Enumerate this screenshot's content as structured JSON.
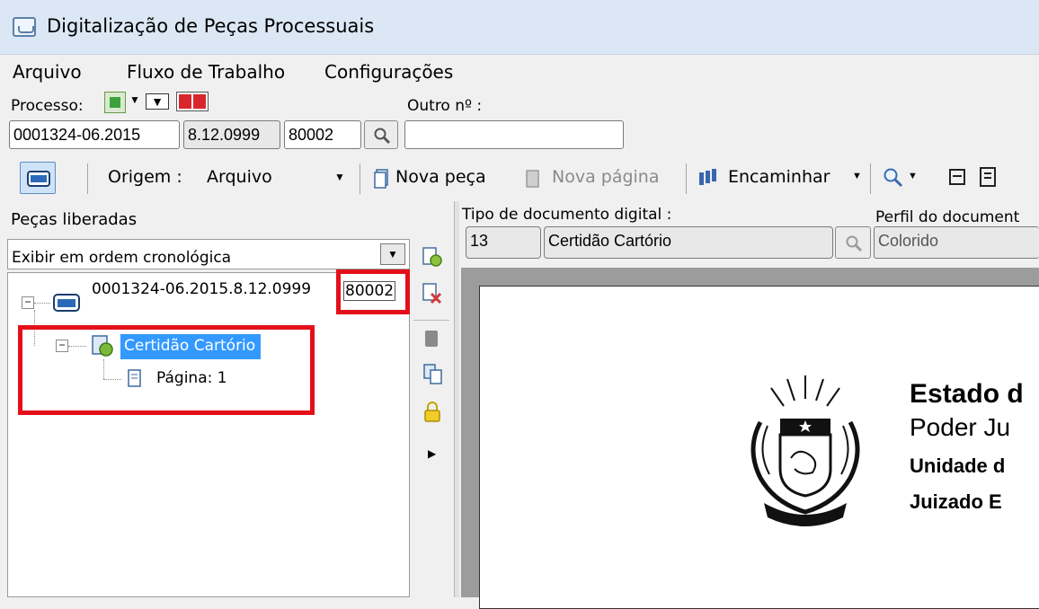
{
  "window": {
    "title": "Digitalização de Peças Processuais"
  },
  "menu": {
    "file": "Arquivo",
    "workflow": "Fluxo de Trabalho",
    "settings": "Configurações"
  },
  "processo": {
    "label": "Processo:",
    "outro_label": "Outro nº :",
    "number_part1": "0001324-06.2015",
    "number_part2": "8.12.0999",
    "number_part3": "80002",
    "outro_value": ""
  },
  "toolbar": {
    "origem_label": "Origem :",
    "origem_value": "Arquivo",
    "nova_peca": "Nova peça",
    "nova_pagina": "Nova página",
    "encaminhar": "Encaminhar"
  },
  "left_panel": {
    "title": "Peças liberadas",
    "order_select": "Exibir em ordem cronológica",
    "tree": {
      "root_label": "0001324-06.2015.8.12.0999",
      "root_suffix": "80002",
      "piece_label": "Certidão Cartório",
      "page_label": "Página: 1"
    }
  },
  "document_type": {
    "label": "Tipo de documento digital :",
    "code": "13",
    "name": "Certidão Cartório"
  },
  "document_profile": {
    "label": "Perfil do document",
    "value": "Colorido"
  },
  "preview": {
    "line1": "Estado d",
    "line2": "Poder Ju",
    "line3": "Unidade d",
    "line4": "Juizado E"
  },
  "colors": {
    "highlight_red": "#e3101b",
    "selection_blue": "#3399ff",
    "titlebar": "#dbe7f4"
  }
}
